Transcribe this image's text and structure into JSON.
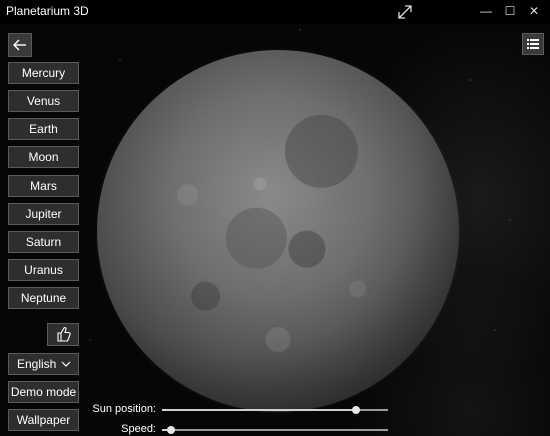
{
  "window": {
    "title": "Planetarium 3D",
    "minimize_glyph": "—",
    "maximize_glyph": "☐",
    "close_glyph": "✕",
    "fullscreen_icon": "expand-diagonal-icon"
  },
  "nav": {
    "back_icon": "back-arrow-icon",
    "planets": [
      "Mercury",
      "Venus",
      "Earth",
      "Moon",
      "Mars",
      "Jupiter",
      "Saturn",
      "Uranus",
      "Neptune"
    ]
  },
  "like_icon": "thumbs-up-icon",
  "language": {
    "selected": "English"
  },
  "buttons": {
    "demo": "Demo mode",
    "wallpaper": "Wallpaper"
  },
  "menu_icon": "list-icon",
  "viewport": {
    "object": "Moon"
  },
  "sliders": {
    "sun_position": {
      "label": "Sun position:",
      "value": 0.86
    },
    "speed": {
      "label": "Speed:",
      "value": 0.04
    }
  },
  "colors": {
    "background": "#050505",
    "button": "#2e2e2e",
    "border": "#5a5a5a"
  }
}
